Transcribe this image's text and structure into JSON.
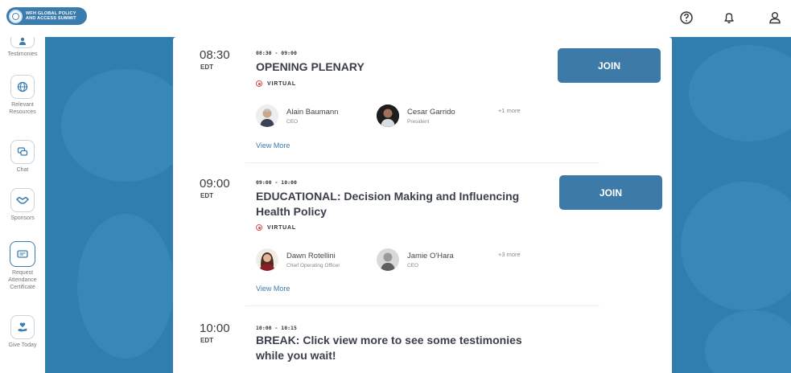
{
  "header": {
    "logo_line1": "WFH GLOBAL POLICY",
    "logo_line2": "AND ACCESS SUMMIT"
  },
  "sidebar": {
    "items": [
      {
        "label": "Testimonies",
        "icon": "person-icon"
      },
      {
        "label": "Relevant Resources",
        "icon": "globe-icon"
      },
      {
        "label": "Chat",
        "icon": "chat-icon"
      },
      {
        "label": "Sponsors",
        "icon": "handshake-icon"
      },
      {
        "label": "Request Attendance Certificate",
        "icon": "certificate-icon"
      },
      {
        "label": "Give Today",
        "icon": "heart-hand-icon"
      }
    ]
  },
  "sessions": [
    {
      "time": "08:30",
      "tz": "EDT",
      "range": "08:30 - 09:00",
      "title": "OPENING PLENARY",
      "mode": "VIRTUAL",
      "speakers": [
        {
          "name": "Alain Baumann",
          "role": "CEO"
        },
        {
          "name": "Cesar Garrido",
          "role": "President"
        }
      ],
      "more": "+1 more",
      "view_more": "View More",
      "join": "JOIN"
    },
    {
      "time": "09:00",
      "tz": "EDT",
      "range": "09:00 - 10:00",
      "title": "EDUCATIONAL: Decision Making and Influencing Health Policy",
      "mode": "VIRTUAL",
      "speakers": [
        {
          "name": "Dawn Rotellini",
          "role": "Chief Operating Officer"
        },
        {
          "name": "Jamie O'Hara",
          "role": "CEO"
        }
      ],
      "more": "+3 more",
      "view_more": "View More",
      "join": "JOIN"
    },
    {
      "time": "10:00",
      "tz": "EDT",
      "range": "10:00 - 10:15",
      "title": "BREAK: Click view more to see some testimonies while you wait!"
    }
  ],
  "colors": {
    "accent": "#3d7aa8",
    "background": "#2f7eae",
    "virtual": "#d9534f"
  }
}
